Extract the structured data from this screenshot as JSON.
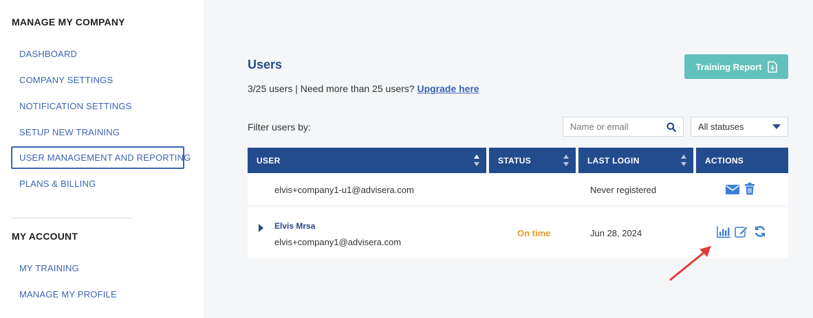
{
  "sidebar": {
    "manage_heading": "MANAGE MY COMPANY",
    "manage_items": [
      {
        "label": "DASHBOARD"
      },
      {
        "label": "COMPANY SETTINGS"
      },
      {
        "label": "NOTIFICATION SETTINGS"
      },
      {
        "label": "SETUP NEW TRAINING"
      },
      {
        "label": "USER MANAGEMENT AND REPORTING",
        "active": true
      },
      {
        "label": "PLANS & BILLING"
      }
    ],
    "account_heading": "MY ACCOUNT",
    "account_items": [
      {
        "label": "MY TRAINING"
      },
      {
        "label": "MANAGE MY PROFILE"
      }
    ]
  },
  "main": {
    "title": "Users",
    "summary_text": "3/25 users | Need more than 25 users? ",
    "upgrade_link": "Upgrade here",
    "training_report_label": "Training Report",
    "filter_label": "Filter users by:",
    "search_placeholder": "Name or email",
    "status_filter_value": "All statuses"
  },
  "table": {
    "columns": {
      "user": "USER",
      "status": "STATUS",
      "last_login": "LAST LOGIN",
      "actions": "ACTIONS"
    },
    "rows": [
      {
        "name": "",
        "email": "elvis+company1-u1@advisera.com",
        "status": "",
        "last_login": "Never registered",
        "actions": [
          "email-icon",
          "trash-icon"
        ]
      },
      {
        "name": "Elvis Mrsa",
        "email": "elvis+company1@advisera.com",
        "status": "On time",
        "last_login": "Jun 28, 2024",
        "actions": [
          "bar-chart-icon",
          "edit-icon",
          "refresh-icon"
        ]
      }
    ]
  },
  "colors": {
    "accent": "#234c8e",
    "link": "#3e63b4",
    "teal_button": "#62c1bd",
    "status_on_time": "#e59a2b",
    "annotation_arrow": "#e03a3a"
  }
}
